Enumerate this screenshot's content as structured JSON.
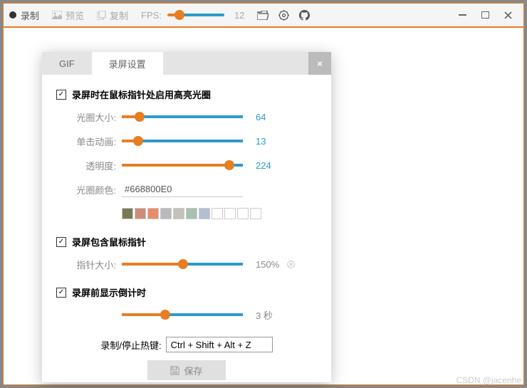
{
  "toolbar": {
    "record": "录制",
    "preview": "预览",
    "copy": "复制",
    "fps_label": "FPS:",
    "fps_value": "12"
  },
  "dialog": {
    "tab_gif": "GIF",
    "tab_settings": "录屏设置",
    "close": "×",
    "section1": {
      "title": "录屏时在鼠标指针处启用高亮光圈",
      "halo_size_label": "光圈大小:",
      "halo_size_value": "64",
      "click_anim_label": "单击动画:",
      "click_anim_value": "13",
      "opacity_label": "透明度:",
      "opacity_value": "224",
      "color_label": "光圈颜色:",
      "color_value": "#668800E0"
    },
    "section2": {
      "title": "录屏包含鼠标指针",
      "pointer_size_label": "指针大小:",
      "pointer_size_value": "150%"
    },
    "section3": {
      "title": "录屏前显示倒计时",
      "countdown_value": "3 秒"
    },
    "hotkey_label": "录制/停止热键:",
    "hotkey_value": "Ctrl + Shift + Alt + Z",
    "save": "保存"
  },
  "swatches": [
    "#7a7a52",
    "#d08a7a",
    "#e88a6a",
    "#bababa",
    "#c2c2b8",
    "#a8c0b0",
    "#b0c0d0",
    "#ffffff",
    "#ffffff",
    "#ffffff",
    "#ffffff"
  ],
  "watermark": "CSDN @jacenhe"
}
